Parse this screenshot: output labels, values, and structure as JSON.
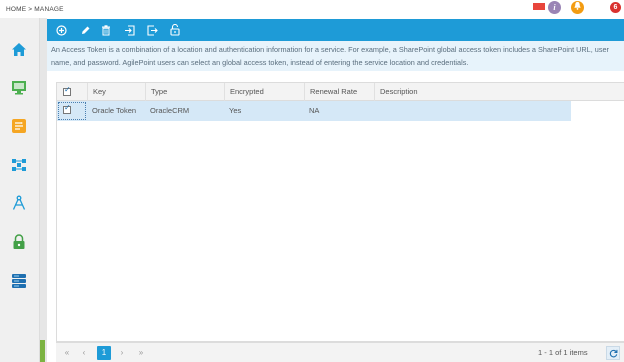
{
  "breadcrumb": "HOME > MANAGE",
  "header": {
    "info_label": "i",
    "notifications_count": "6"
  },
  "sidebar": {
    "items": [
      {
        "name": "home-icon"
      },
      {
        "name": "monitor-icon"
      },
      {
        "name": "workflow-icon"
      },
      {
        "name": "process-icon"
      },
      {
        "name": "compass-icon"
      },
      {
        "name": "lock-icon"
      },
      {
        "name": "database-icon"
      }
    ]
  },
  "toolbar": {
    "buttons": [
      {
        "name": "add-button",
        "icon": "plus-circle-icon"
      },
      {
        "name": "edit-button",
        "icon": "pencil-icon"
      },
      {
        "name": "delete-button",
        "icon": "trash-icon"
      },
      {
        "name": "import-button",
        "icon": "import-icon"
      },
      {
        "name": "export-button",
        "icon": "export-icon"
      },
      {
        "name": "unlock-button",
        "icon": "unlock-icon"
      }
    ]
  },
  "description": "An Access Token is a combination of a location and authentication information for a service. For example, a SharePoint global access token includes a SharePoint URL, user name, and password. AgilePoint users can select an global access token, instead of entering the service location and credentials.",
  "table": {
    "columns": [
      "Key",
      "Type",
      "Encrypted",
      "Renewal Rate",
      "Description"
    ],
    "rows": [
      {
        "key": "Oracle Token",
        "type": "OracleCRM",
        "encrypted": "Yes",
        "renewal_rate": "NA",
        "description": "",
        "selected": true
      }
    ]
  },
  "pager": {
    "first": "«",
    "prev": "‹",
    "current_page": "1",
    "next": "›",
    "last": "»",
    "info": "1 - 1 of 1 items"
  },
  "colors": {
    "accent": "#1e9bd7",
    "row_selected": "#d5e8f7",
    "description_bg": "#e7f3fb"
  }
}
